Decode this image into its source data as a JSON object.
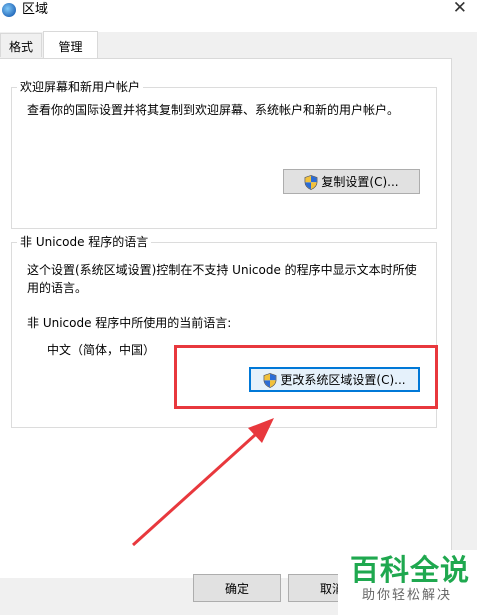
{
  "window": {
    "title": "区域",
    "close_glyph": "✕"
  },
  "tabs": [
    {
      "label": "格式",
      "selected": false
    },
    {
      "label": "管理",
      "selected": true
    }
  ],
  "welcome_group": {
    "legend": "欢迎屏幕和新用户帐户",
    "description": "查看你的国际设置并将其复制到欢迎屏幕、系统帐户和新的用户帐户。",
    "copy_button": "复制设置(C)..."
  },
  "unicode_group": {
    "legend": "非 Unicode 程序的语言",
    "description_line1": "这个设置(系统区域设置)控制在不支持 Unicode 的程序中显示文本时所使",
    "description_line2": "用的语言。",
    "current_label": "非 Unicode 程序中所使用的当前语言:",
    "current_value": "中文（简体，中国）",
    "change_button": "更改系统区域设置(C)..."
  },
  "footer": {
    "ok_button": "确定",
    "cancel_button": "取消"
  },
  "watermark": {
    "brand": "百科全说",
    "slogan": "助你轻松解决"
  },
  "colors": {
    "highlight": "#e8383d",
    "brand_green": "#1fa84f",
    "focus_blue": "#0078d7"
  },
  "icons": {
    "window": "globe-icon",
    "button": "uac-shield-icon"
  }
}
